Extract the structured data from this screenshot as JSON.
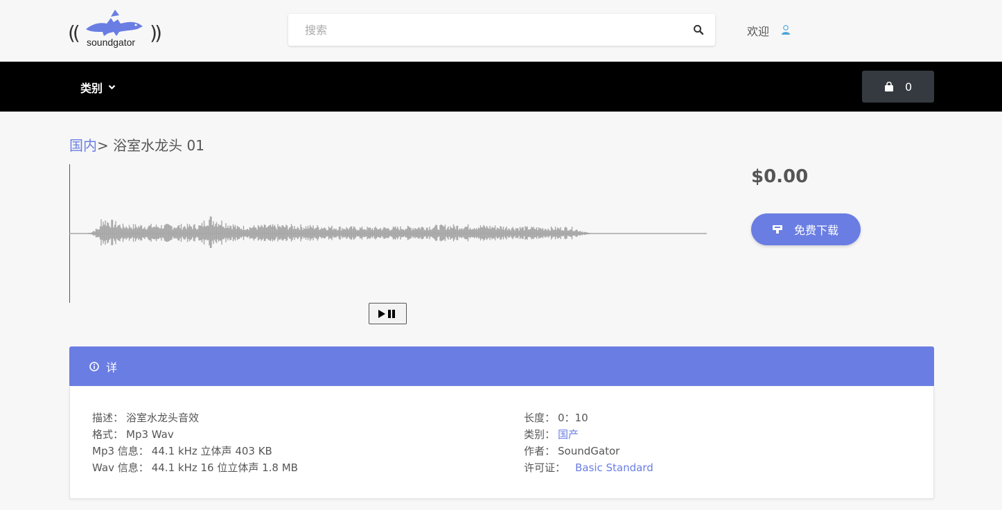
{
  "header": {
    "logo_text": "soundgator",
    "search_placeholder": "搜索",
    "search_value": "",
    "welcome": "欢迎"
  },
  "nav": {
    "category_label": "类别",
    "cart_count": "0"
  },
  "breadcrumb": {
    "parent": "国内",
    "separator": ">",
    "current": "浴室水龙头 01"
  },
  "product": {
    "price": "$0.00",
    "download_label": "免费下载"
  },
  "details": {
    "title": "详",
    "left": [
      {
        "key": "描述：",
        "value": "浴室水龙头音效"
      },
      {
        "key": "格式：",
        "value": "Mp3 Wav"
      },
      {
        "key": "Mp3 信息：",
        "value": "44.1 kHz 立体声 403 KB"
      },
      {
        "key": "Wav 信息：",
        "value": "44.1 kHz 16 位立体声 1.8 MB"
      }
    ],
    "right": [
      {
        "key": "长度：",
        "value": "0：10"
      },
      {
        "key": "类别：",
        "value": "国产"
      },
      {
        "key": "作者：",
        "value": "SoundGator"
      },
      {
        "key": "许可证：",
        "value": "Basic Standard"
      }
    ]
  },
  "colors": {
    "accent": "#6a7de3",
    "navbar": "#000000",
    "cart_bg": "#343a40",
    "waveform": "#a6a6a6"
  },
  "icons": [
    "gator-logo-icon",
    "search-icon",
    "user-icon",
    "chevron-down-icon",
    "bag-icon",
    "play-pause-icon",
    "download-icon",
    "info-icon"
  ]
}
